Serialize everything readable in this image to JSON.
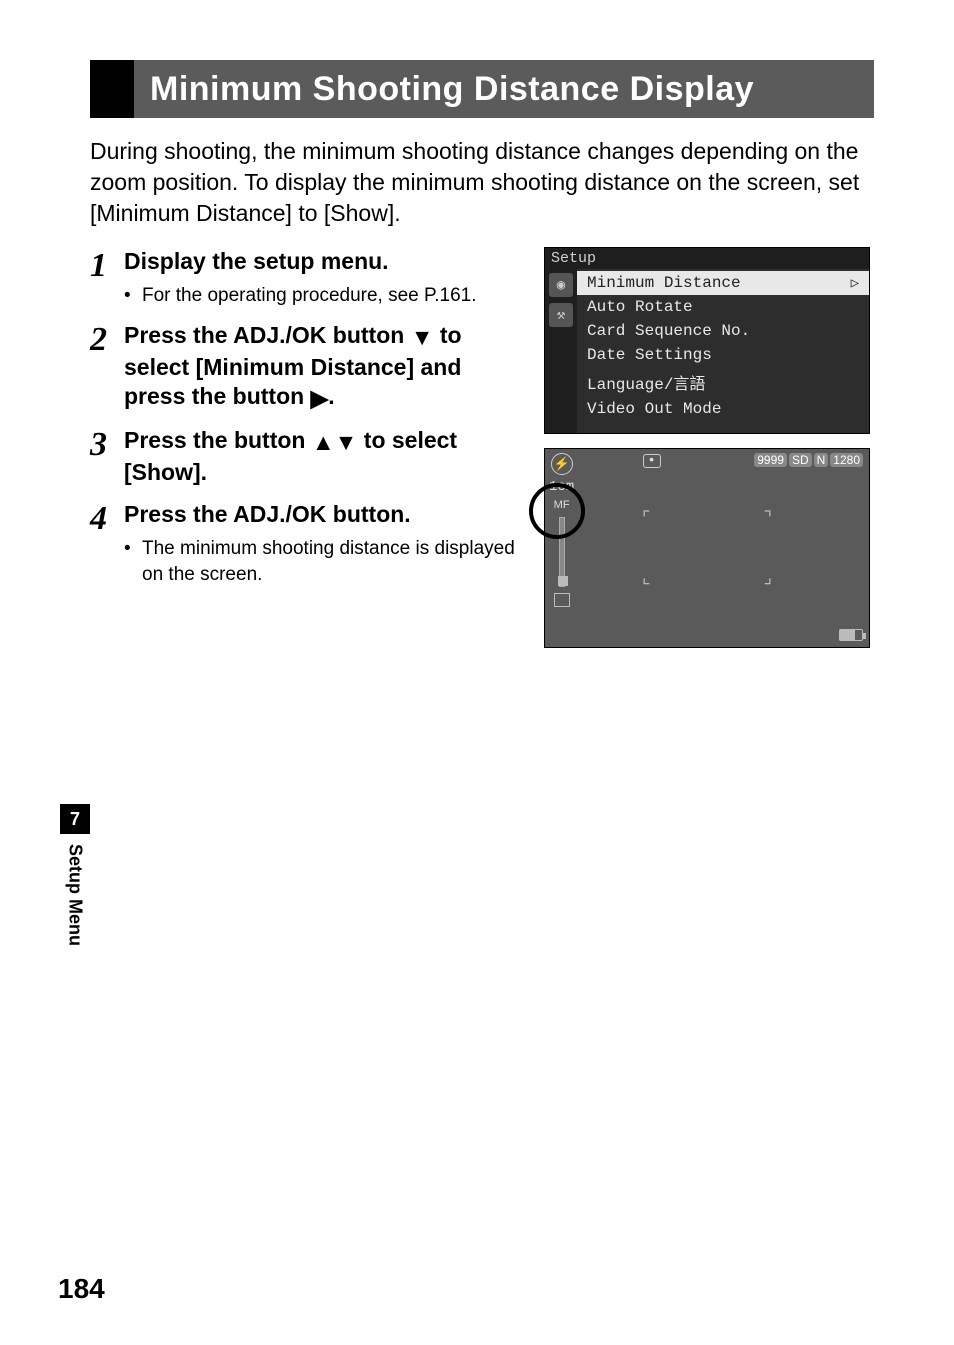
{
  "title": "Minimum Shooting Distance Display",
  "intro": "During shooting, the minimum shooting distance changes depending on the zoom position. To display the minimum shooting distance on the screen, set [Minimum Distance] to [Show].",
  "steps": [
    {
      "num": "1",
      "text": "Display the setup menu.",
      "bullets": [
        "For the operating procedure, see P.161."
      ]
    },
    {
      "num": "2",
      "text_parts": [
        "Press the ADJ./OK button ",
        "▼",
        " to select [Minimum Distance] and press the button ",
        "▶",
        "."
      ]
    },
    {
      "num": "3",
      "text_parts": [
        "Press the button ",
        "▲▼",
        " to select [Show]."
      ]
    },
    {
      "num": "4",
      "text": "Press the ADJ./OK button.",
      "bullets": [
        "The minimum shooting distance is displayed on the screen."
      ]
    }
  ],
  "setup_menu": {
    "tab": "Setup",
    "items": [
      "Minimum Distance",
      "Auto Rotate",
      "Card Sequence No.",
      "Date Settings",
      "Language/言語",
      "Video Out Mode"
    ],
    "selected_index": 0
  },
  "live_view": {
    "top_counter": "9999",
    "badges": [
      "SD",
      "N",
      "1280"
    ],
    "left_distance": "1cm"
  },
  "sidetab": {
    "num": "7",
    "label": "Setup Menu"
  },
  "page_number": "184"
}
